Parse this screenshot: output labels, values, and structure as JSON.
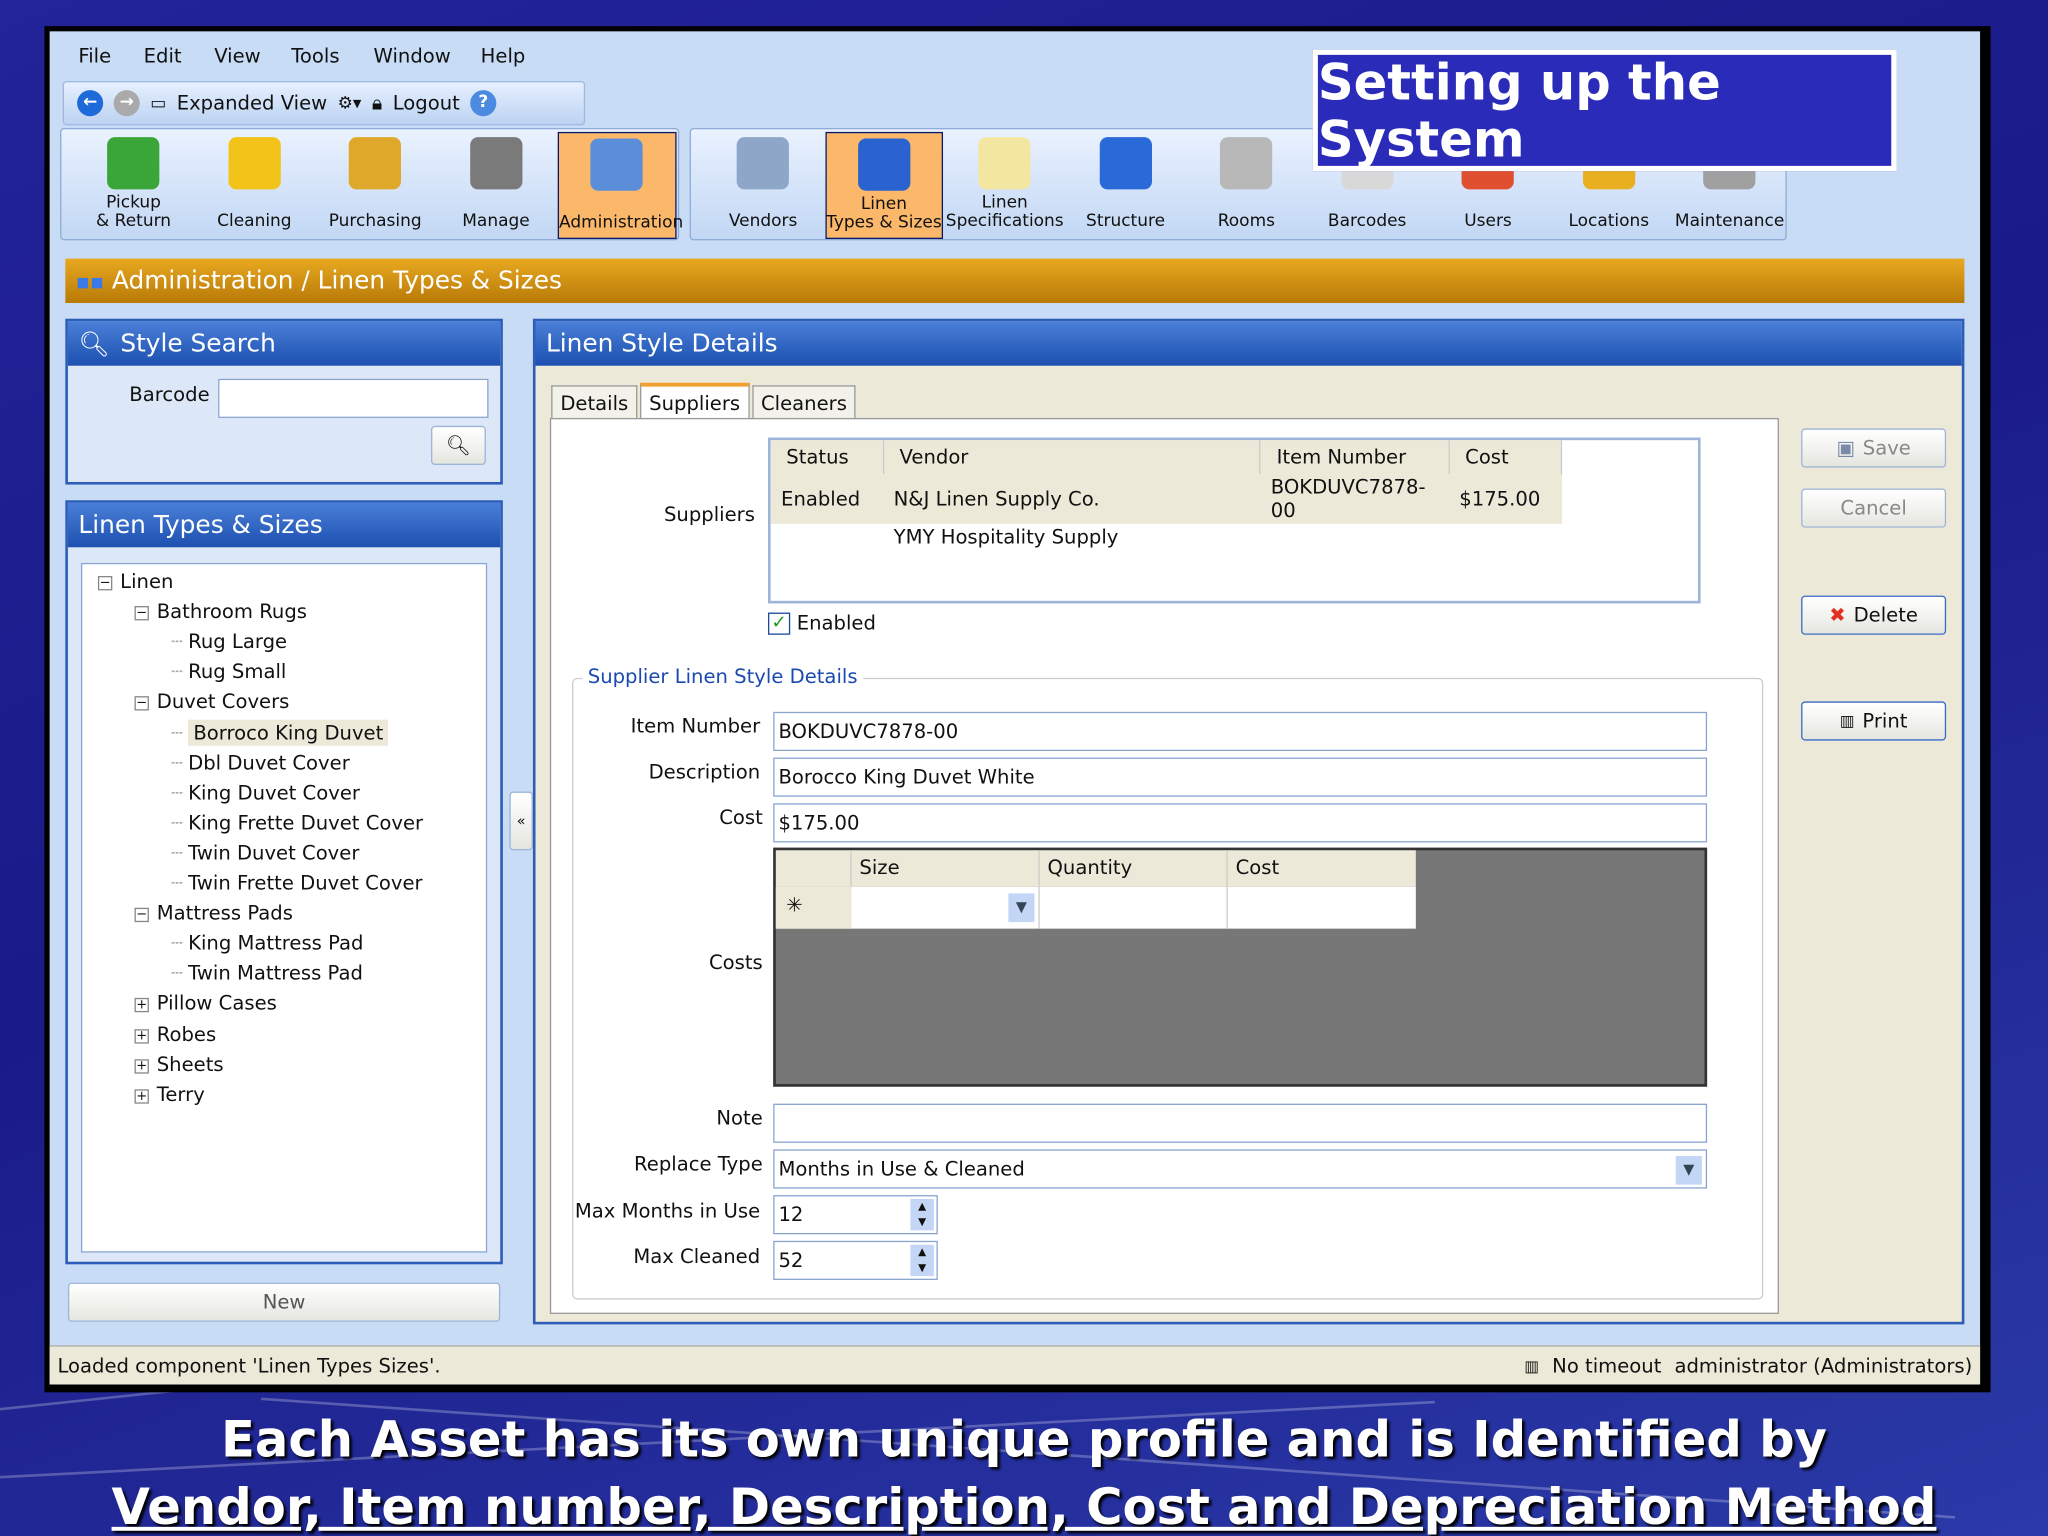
{
  "menu": [
    "File",
    "Edit",
    "View",
    "Tools",
    "Window",
    "Help"
  ],
  "toolbar": {
    "expanded_view": "Expanded View",
    "logout": "Logout"
  },
  "ribbon_group1": [
    {
      "l1": "Pickup",
      "l2": "& Return",
      "icon": "pickup-return-icon",
      "color": "#3aa63a"
    },
    {
      "l1": "",
      "l2": "Cleaning",
      "icon": "cleaning-bag-icon",
      "color": "#f2c419"
    },
    {
      "l1": "",
      "l2": "Purchasing",
      "icon": "purchasing-box-icon",
      "color": "#e0a82a"
    },
    {
      "l1": "",
      "l2": "Manage",
      "icon": "manage-briefcase-icon",
      "color": "#7a7a7a"
    },
    {
      "l1": "",
      "l2": "Administration",
      "icon": "administration-computer-icon",
      "color": "#5a8ed8"
    }
  ],
  "ribbon_group2": [
    {
      "l1": "",
      "l2": "Vendors",
      "icon": "vendors-building-icon",
      "color": "#8ea6c8"
    },
    {
      "l1": "Linen",
      "l2": "Types & Sizes",
      "icon": "linen-types-icon",
      "color": "#2a62d0"
    },
    {
      "l1": "Linen",
      "l2": "Specifications",
      "icon": "specifications-doc-icon",
      "color": "#f3e6a0"
    },
    {
      "l1": "",
      "l2": "Structure",
      "icon": "structure-globe-icon",
      "color": "#2a6ad8"
    },
    {
      "l1": "",
      "l2": "Rooms",
      "icon": "rooms-icon",
      "color": "#b8b8b8"
    },
    {
      "l1": "",
      "l2": "Barcodes",
      "icon": "barcode-icon",
      "color": "#d8d8d8"
    },
    {
      "l1": "",
      "l2": "Users",
      "icon": "users-icon",
      "color": "#e05030"
    },
    {
      "l1": "",
      "l2": "Locations",
      "icon": "locations-icon",
      "color": "#e8b020"
    },
    {
      "l1": "",
      "l2": "Maintenance",
      "icon": "maintenance-icon",
      "color": "#a0a0a0"
    }
  ],
  "overlay_title": "Setting up the System",
  "breadcrumb": "Administration / Linen Types & Sizes",
  "style_search": {
    "title": "Style Search",
    "barcode_label": "Barcode",
    "barcode_value": ""
  },
  "linen_types": {
    "title": "Linen Types & Sizes",
    "new_label": "New",
    "tree": [
      {
        "t": "Linen",
        "lvl": 0,
        "pm": "−"
      },
      {
        "t": "Bathroom Rugs",
        "lvl": 1,
        "pm": "−"
      },
      {
        "t": "Rug Large",
        "lvl": 2
      },
      {
        "t": "Rug Small",
        "lvl": 2
      },
      {
        "t": "Duvet Covers",
        "lvl": 1,
        "pm": "−"
      },
      {
        "t": "Borroco King Duvet",
        "lvl": 2,
        "sel": true
      },
      {
        "t": "Dbl Duvet Cover",
        "lvl": 2
      },
      {
        "t": "King Duvet Cover",
        "lvl": 2
      },
      {
        "t": "King Frette Duvet Cover",
        "lvl": 2
      },
      {
        "t": "Twin Duvet Cover",
        "lvl": 2
      },
      {
        "t": "Twin Frette Duvet Cover",
        "lvl": 2
      },
      {
        "t": "Mattress Pads",
        "lvl": 1,
        "pm": "−"
      },
      {
        "t": "King Mattress Pad",
        "lvl": 2
      },
      {
        "t": "Twin Mattress Pad",
        "lvl": 2
      },
      {
        "t": "Pillow Cases",
        "lvl": 1,
        "pm": "+"
      },
      {
        "t": "Robes",
        "lvl": 1,
        "pm": "+"
      },
      {
        "t": "Sheets",
        "lvl": 1,
        "pm": "+"
      },
      {
        "t": "Terry",
        "lvl": 1,
        "pm": "+"
      }
    ]
  },
  "details": {
    "title": "Linen Style Details",
    "tabs": [
      "Details",
      "Suppliers",
      "Cleaners"
    ],
    "suppliers_label": "Suppliers",
    "grid_headers": [
      "Status",
      "Vendor",
      "Item Number",
      "Cost"
    ],
    "grid_rows": [
      [
        "Enabled",
        "N&J Linen Supply Co.",
        "BOKDUVC7878-00",
        "$175.00"
      ],
      [
        "",
        "YMY Hospitality Supply",
        "",
        ""
      ]
    ],
    "enabled_label": "Enabled",
    "group_title": "Supplier Linen Style Details",
    "item_number_label": "Item Number",
    "item_number": "BOKDUVC7878-00",
    "description_label": "Description",
    "description": "Borocco King Duvet White",
    "cost_label": "Cost",
    "cost": "$175.00",
    "costs_label": "Costs",
    "costs_headers": [
      "Size",
      "Quantity",
      "Cost"
    ],
    "new_row_marker": "✳",
    "note_label": "Note",
    "note": "",
    "replace_type_label": "Replace Type",
    "replace_type": "Months in Use & Cleaned",
    "max_months_label": "Max Months in Use",
    "max_months": "12",
    "max_cleaned_label": "Max Cleaned",
    "max_cleaned": "52"
  },
  "actions": {
    "save": "Save",
    "cancel": "Cancel",
    "delete": "Delete",
    "print": "Print"
  },
  "status": {
    "left": "Loaded component 'Linen Types  Sizes'.",
    "timeout": "No timeout",
    "user": "administrator (Administrators)"
  },
  "caption": {
    "line1": "Each Asset has its own unique profile and is Identified by",
    "line2": "Vendor, Item number, Description, Cost and Depreciation Method"
  }
}
